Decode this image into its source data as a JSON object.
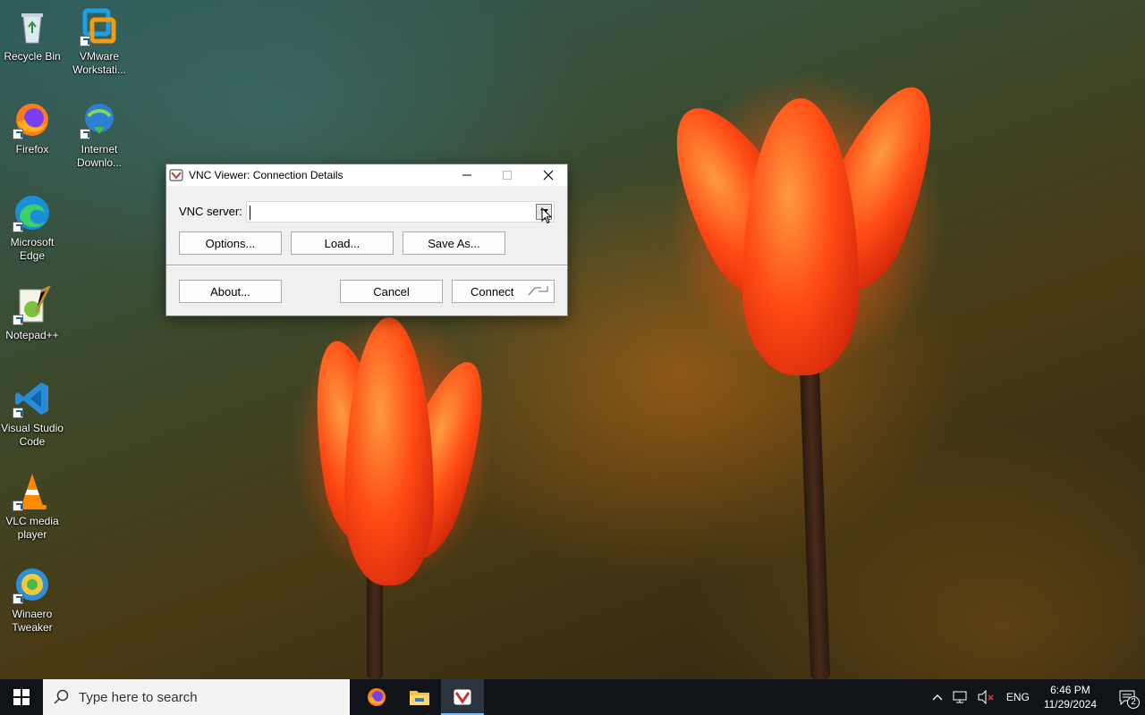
{
  "desktop": {
    "icons": [
      {
        "label": "Recycle Bin"
      },
      {
        "label": "VMware Workstati..."
      },
      {
        "label": "Firefox"
      },
      {
        "label": "Internet Downlo..."
      },
      {
        "label": "Microsoft Edge"
      },
      {
        "label": "Notepad++"
      },
      {
        "label": "Visual Studio Code"
      },
      {
        "label": "VLC media player"
      },
      {
        "label": "Winaero Tweaker"
      }
    ]
  },
  "dialog": {
    "title": "VNC Viewer: Connection Details",
    "server_label": "VNC server:",
    "server_value": "",
    "buttons": {
      "options": "Options...",
      "load": "Load...",
      "save_as": "Save As...",
      "about": "About...",
      "cancel": "Cancel",
      "connect": "Connect"
    }
  },
  "taskbar": {
    "search_placeholder": "Type here to search",
    "apps": [
      "firefox-icon",
      "file-explorer-icon",
      "vnc-viewer-icon"
    ],
    "tray": {
      "language": "ENG",
      "time": "6:46 PM",
      "date": "11/29/2024",
      "notification_count": "2"
    }
  },
  "colors": {
    "taskbar_bg": "#101418",
    "accent": "#79b8f3"
  }
}
